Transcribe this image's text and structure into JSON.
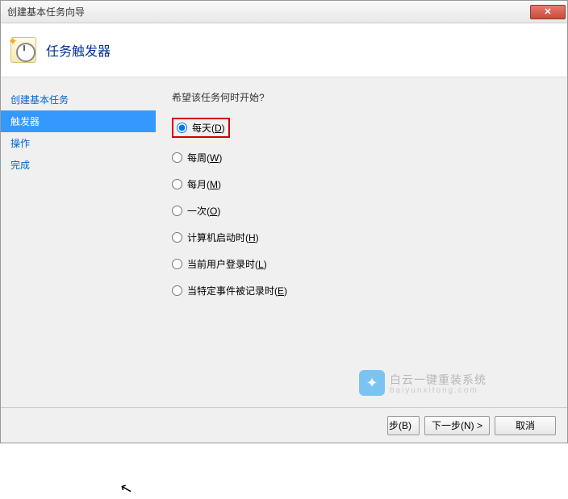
{
  "window": {
    "title": "创建基本任务向导",
    "close_symbol": "✕"
  },
  "header": {
    "title": "任务触发器"
  },
  "sidebar": {
    "items": [
      {
        "label": "创建基本任务",
        "active": false
      },
      {
        "label": "触发器",
        "active": true
      },
      {
        "label": "操作",
        "active": false
      },
      {
        "label": "完成",
        "active": false
      }
    ]
  },
  "content": {
    "prompt": "希望该任务何时开始?",
    "options": [
      {
        "label": "每天(",
        "accel": "D",
        "suffix": ")",
        "selected": true,
        "highlighted": true
      },
      {
        "label": "每周(",
        "accel": "W",
        "suffix": ")",
        "selected": false,
        "highlighted": false
      },
      {
        "label": "每月(",
        "accel": "M",
        "suffix": ")",
        "selected": false,
        "highlighted": false
      },
      {
        "label": "一次(",
        "accel": "O",
        "suffix": ")",
        "selected": false,
        "highlighted": false
      },
      {
        "label": "计算机启动时(",
        "accel": "H",
        "suffix": ")",
        "selected": false,
        "highlighted": false
      },
      {
        "label": "当前用户登录时(",
        "accel": "L",
        "suffix": ")",
        "selected": false,
        "highlighted": false
      },
      {
        "label": "当特定事件被记录时(",
        "accel": "E",
        "suffix": ")",
        "selected": false,
        "highlighted": false
      }
    ]
  },
  "footer": {
    "back_partial": "步(B)",
    "next": "下一步(N) >",
    "cancel": "取消"
  },
  "watermark": {
    "text": "白云一键重装系统",
    "sub": "baiyunxitong.com"
  }
}
